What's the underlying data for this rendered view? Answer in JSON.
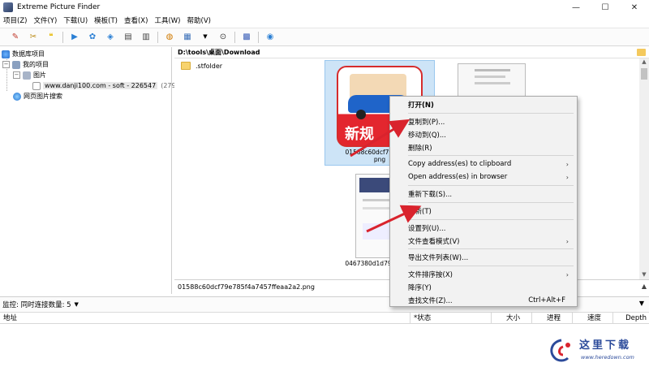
{
  "window": {
    "title": "Extreme Picture Finder",
    "minimize": "—",
    "maximize": "☐",
    "close": "✕"
  },
  "menu": [
    "项目(Z)",
    "文件(Y)",
    "下载(U)",
    "模板(T)",
    "查看(X)",
    "工具(W)",
    "帮助(V)"
  ],
  "tree": {
    "root": "数据库项目",
    "my_projects": "我的项目",
    "pictures": "图片",
    "site": "www.danji100.com - soft - 226547",
    "site_count": "(279)",
    "web_search": "网页图片搜索"
  },
  "path": "D:\\tools\\桌面\\Download",
  "folder_item": ".stfolder",
  "thumbs": [
    {
      "caption": "01588c60dcf79e785f4\npng"
    },
    {
      "caption": ""
    },
    {
      "caption": "0467380d1d7945921c"
    }
  ],
  "thumb_banner_text": "新规",
  "selected_file": "01588c60dcf79e785f4a7457ffeaa2a2.png",
  "monitor_label": "监控: 同时连接数量: 5",
  "columns": {
    "address": "地址",
    "status": "*状态",
    "size": "大小",
    "progress": "进程",
    "speed": "速度",
    "depth": "Depth"
  },
  "context_menu": {
    "open": "打开(N)",
    "copy_to": "复制到(P)...",
    "move_to": "移动到(Q)...",
    "delete": "删除(R)",
    "copy_address": "Copy address(es) to clipboard",
    "open_address": "Open address(es) in browser",
    "redownload": "重新下载(S)...",
    "refresh": "刷新(T)",
    "set_columns": "设置列(U)...",
    "view_mode": "文件查看模式(V)",
    "export_list": "导出文件列表(W)...",
    "sort_by": "文件排序按(X)",
    "descending": "降序(Y)",
    "find_file": "查找文件(Z)...",
    "find_shortcut": "Ctrl+Alt+F"
  },
  "watermark": {
    "title": "这里下载",
    "url": "www.heredown.com"
  },
  "colors": {
    "selection": "#cde4f7",
    "arrow": "#d9232d",
    "watermark": "#2b4a9a"
  }
}
